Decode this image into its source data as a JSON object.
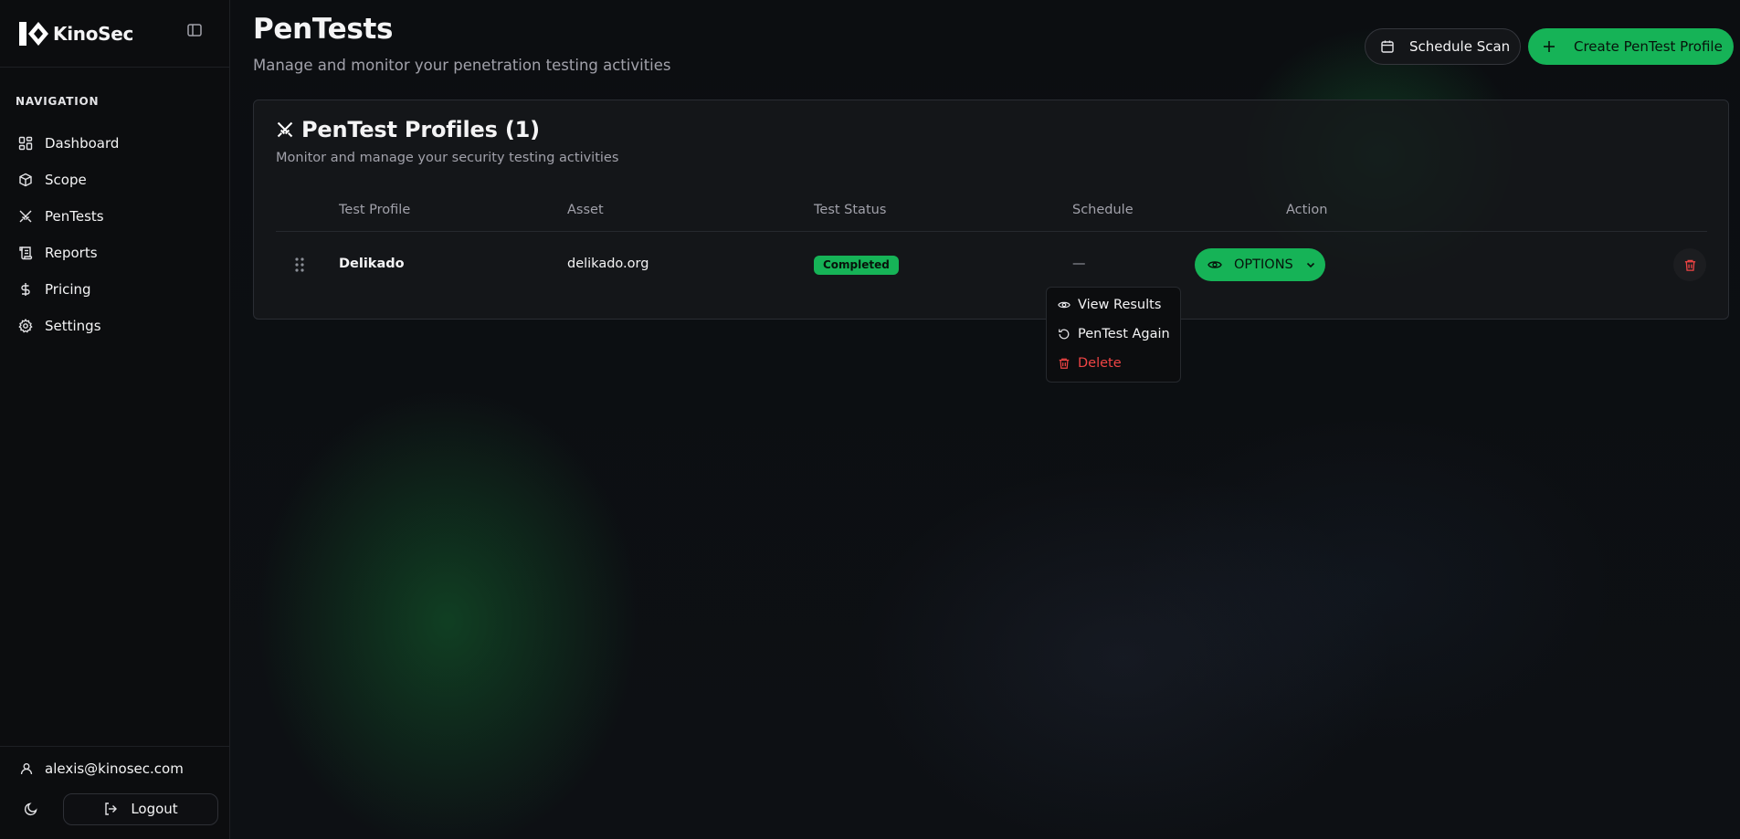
{
  "app": {
    "name": "KinoSec"
  },
  "sidebar": {
    "heading": "NAVIGATION",
    "items": [
      {
        "label": "Dashboard",
        "icon": "dashboard-icon"
      },
      {
        "label": "Scope",
        "icon": "cube-icon"
      },
      {
        "label": "PenTests",
        "icon": "swords-icon"
      },
      {
        "label": "Reports",
        "icon": "scroll-icon"
      },
      {
        "label": "Pricing",
        "icon": "dollar-icon"
      },
      {
        "label": "Settings",
        "icon": "gear-icon"
      }
    ],
    "user_email": "alexis@kinosec.com",
    "logout_label": "Logout"
  },
  "header": {
    "title": "PenTests",
    "subtitle": "Manage and monitor your penetration testing activities",
    "schedule_label": "Schedule Scan",
    "create_label": "Create PenTest Profile"
  },
  "card": {
    "title": "PenTest Profiles (1)",
    "subtitle": "Monitor and manage your security testing activities",
    "columns": [
      "Test Profile",
      "Asset",
      "Test Status",
      "Schedule",
      "Action"
    ],
    "rows": [
      {
        "profile": "Delikado",
        "asset": "delikado.org",
        "status": "Completed",
        "schedule": "—",
        "action_label": "OPTIONS"
      }
    ]
  },
  "dropdown": {
    "items": [
      {
        "label": "View Results",
        "icon": "eye-icon"
      },
      {
        "label": "PenTest Again",
        "icon": "rotate-icon"
      },
      {
        "label": "Delete",
        "icon": "trash-icon"
      }
    ]
  },
  "colors": {
    "accent": "#16b357",
    "danger": "#ef4444",
    "background": "#0b0d10"
  }
}
